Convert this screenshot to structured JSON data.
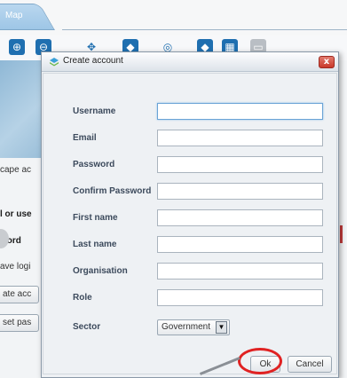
{
  "background": {
    "tab_label": "Map",
    "left_panel": {
      "text1": "cape ac",
      "text2": "l or use",
      "text3": "word",
      "text4": "ave logi",
      "button1": "ate acc",
      "button2": "set pas"
    }
  },
  "dialog": {
    "title": "Create account",
    "close_label": "x",
    "fields": [
      {
        "label": "Username",
        "value": ""
      },
      {
        "label": "Email",
        "value": ""
      },
      {
        "label": "Password",
        "value": ""
      },
      {
        "label": "Confirm Password",
        "value": ""
      },
      {
        "label": "First name",
        "value": ""
      },
      {
        "label": "Last name",
        "value": ""
      },
      {
        "label": "Organisation",
        "value": ""
      },
      {
        "label": "Role",
        "value": ""
      }
    ],
    "sector": {
      "label": "Sector",
      "selected": "Government"
    },
    "ok_label": "Ok",
    "cancel_label": "Cancel"
  },
  "colors": {
    "accent": "#1f6fb0",
    "label": "#3c4a5c",
    "highlight_ring": "#e02222"
  }
}
